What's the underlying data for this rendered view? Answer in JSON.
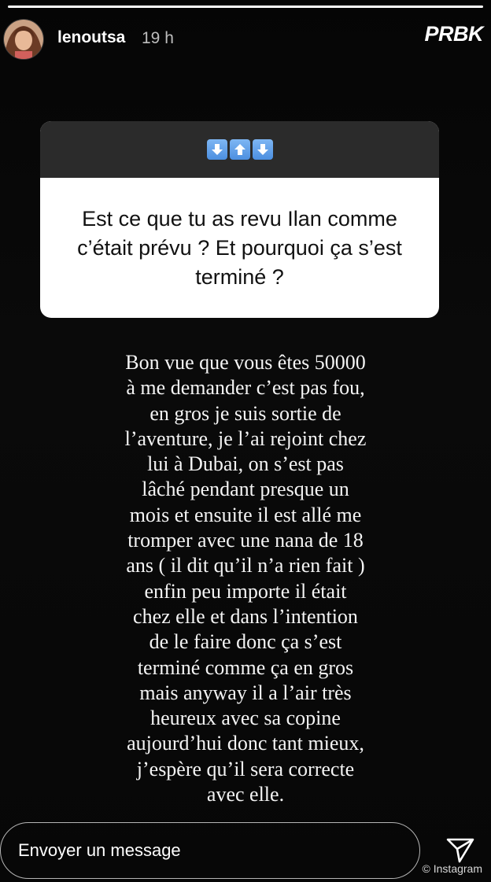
{
  "header": {
    "username": "lenoutsa",
    "time": "19 h",
    "logo": "PRBK",
    "progress": 1.0
  },
  "sticker": {
    "emojis": [
      "down-arrow-icon",
      "up-arrow-icon",
      "down-arrow-icon"
    ],
    "question": "Est ce que tu as revu Ilan comme c’était prévu ? Et pourquoi ça s’est terminé ?",
    "accent": "#4b8fe0"
  },
  "answer": {
    "text": "Bon vue que vous êtes 50000\nà me demander c’est pas fou,\nen gros je suis sortie de\nl’aventure, je l’ai rejoint chez\nlui à Dubai, on s’est pas\nlâché pendant presque un\nmois et ensuite il est allé me\ntromper avec une nana de 18\nans ( il dit qu’il n’a rien fait )\nenfin peu importe il était\nchez elle et dans l’intention\nde le faire donc ça s’est\nterminé comme ça en gros\nmais anyway il a l’air très\nheureux avec sa copine\naujourd’hui donc tant mieux,\nj’espère qu’il sera correcte\navec elle."
  },
  "footer": {
    "message_placeholder": "Envoyer un message",
    "send_icon": "send-icon",
    "watermark": "© Instagram"
  }
}
